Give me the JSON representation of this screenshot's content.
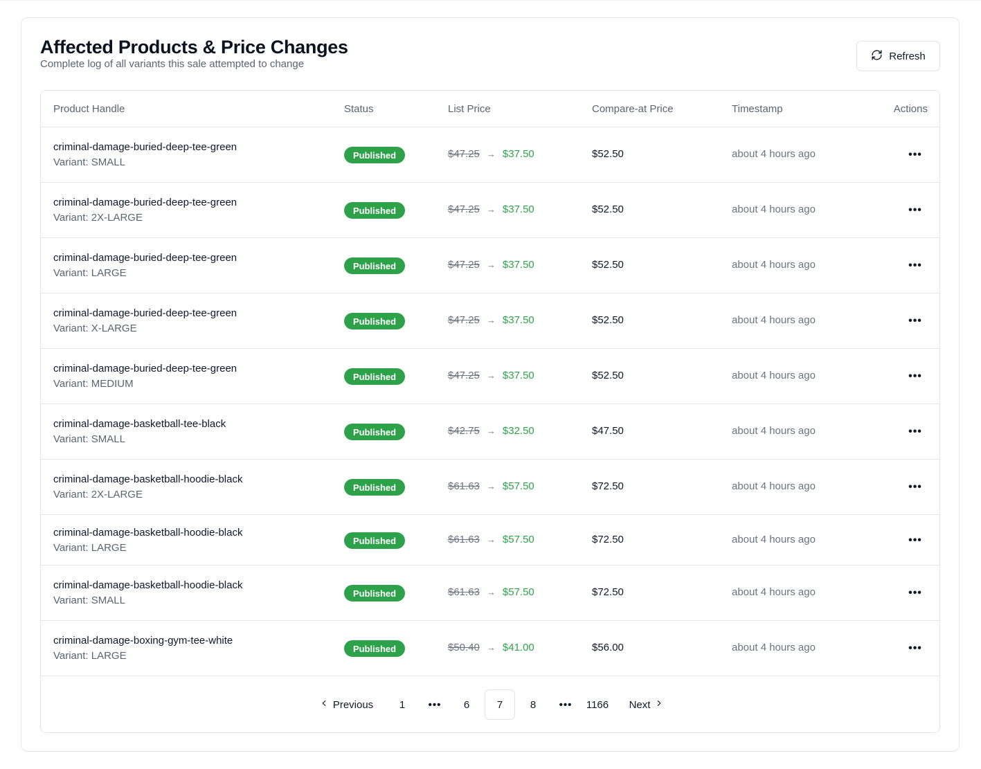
{
  "header": {
    "title": "Affected Products & Price Changes",
    "subtitle": "Complete log of all variants this sale attempted to change",
    "refresh_label": "Refresh"
  },
  "table": {
    "columns": [
      "Product Handle",
      "Status",
      "List Price",
      "Compare-at Price",
      "Timestamp",
      "Actions"
    ],
    "rows": [
      {
        "handle": "criminal-damage-buried-deep-tee-green",
        "variant": "Variant: SMALL",
        "status": "Published",
        "old_price": "$47.25",
        "new_price": "$37.50",
        "compare_at": "$52.50",
        "timestamp": "about 4 hours ago"
      },
      {
        "handle": "criminal-damage-buried-deep-tee-green",
        "variant": "Variant: 2X-LARGE",
        "status": "Published",
        "old_price": "$47.25",
        "new_price": "$37.50",
        "compare_at": "$52.50",
        "timestamp": "about 4 hours ago"
      },
      {
        "handle": "criminal-damage-buried-deep-tee-green",
        "variant": "Variant: LARGE",
        "status": "Published",
        "old_price": "$47.25",
        "new_price": "$37.50",
        "compare_at": "$52.50",
        "timestamp": "about 4 hours ago"
      },
      {
        "handle": "criminal-damage-buried-deep-tee-green",
        "variant": "Variant: X-LARGE",
        "status": "Published",
        "old_price": "$47.25",
        "new_price": "$37.50",
        "compare_at": "$52.50",
        "timestamp": "about 4 hours ago"
      },
      {
        "handle": "criminal-damage-buried-deep-tee-green",
        "variant": "Variant: MEDIUM",
        "status": "Published",
        "old_price": "$47.25",
        "new_price": "$37.50",
        "compare_at": "$52.50",
        "timestamp": "about 4 hours ago"
      },
      {
        "handle": "criminal-damage-basketball-tee-black",
        "variant": "Variant: SMALL",
        "status": "Published",
        "old_price": "$42.75",
        "new_price": "$32.50",
        "compare_at": "$47.50",
        "timestamp": "about 4 hours ago"
      },
      {
        "handle": "criminal-damage-basketball-hoodie-black",
        "variant": "Variant: 2X-LARGE",
        "status": "Published",
        "old_price": "$61.63",
        "new_price": "$57.50",
        "compare_at": "$72.50",
        "timestamp": "about 4 hours ago"
      },
      {
        "handle": "criminal-damage-basketball-hoodie-black",
        "variant": "Variant: LARGE",
        "status": "Published",
        "old_price": "$61.63",
        "new_price": "$57.50",
        "compare_at": "$72.50",
        "timestamp": "about 4 hours ago"
      },
      {
        "handle": "criminal-damage-basketball-hoodie-black",
        "variant": "Variant: SMALL",
        "status": "Published",
        "old_price": "$61.63",
        "new_price": "$57.50",
        "compare_at": "$72.50",
        "timestamp": "about 4 hours ago"
      },
      {
        "handle": "criminal-damage-boxing-gym-tee-white",
        "variant": "Variant: LARGE",
        "status": "Published",
        "old_price": "$50.40",
        "new_price": "$41.00",
        "compare_at": "$56.00",
        "timestamp": "about 4 hours ago"
      }
    ]
  },
  "pagination": {
    "previous_label": "Previous",
    "next_label": "Next",
    "pages": [
      "1",
      "6",
      "7",
      "8",
      "1166"
    ],
    "current_page": "7"
  },
  "colors": {
    "published_badge": "#2ea24a",
    "new_price": "#2ea24a",
    "muted_text": "#6b7280"
  },
  "icons": {
    "refresh": "refresh-icon",
    "actions": "more-horizontal-icon",
    "previous": "chevron-left-icon",
    "next": "chevron-right-icon",
    "ellipsis": "ellipsis-icon",
    "arrow": "arrow-right-icon"
  }
}
